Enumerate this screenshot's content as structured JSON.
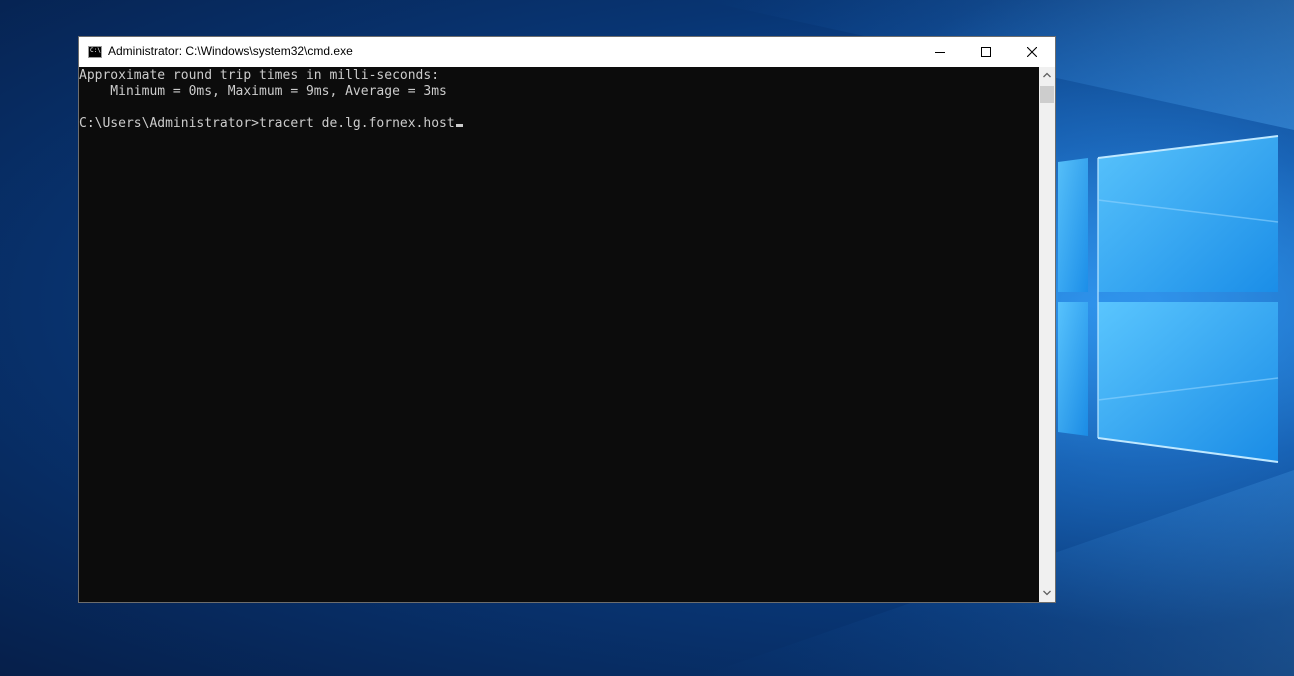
{
  "window": {
    "title": "Administrator: C:\\Windows\\system32\\cmd.exe",
    "icon": "cmd-icon",
    "icon_text": "C:\\"
  },
  "controls": {
    "minimize": "minimize-icon",
    "maximize": "maximize-icon",
    "close": "close-icon"
  },
  "console": {
    "lines": [
      "Approximate round trip times in milli-seconds:",
      "    Minimum = 0ms, Maximum = 9ms, Average = 3ms",
      "",
      "C:\\Users\\Administrator>tracert de.lg.fornex.host"
    ]
  },
  "colors": {
    "console_bg": "#0c0c0c",
    "console_fg": "#cccccc",
    "titlebar_bg": "#ffffff",
    "desktop_accent": "#1f7fd8"
  }
}
